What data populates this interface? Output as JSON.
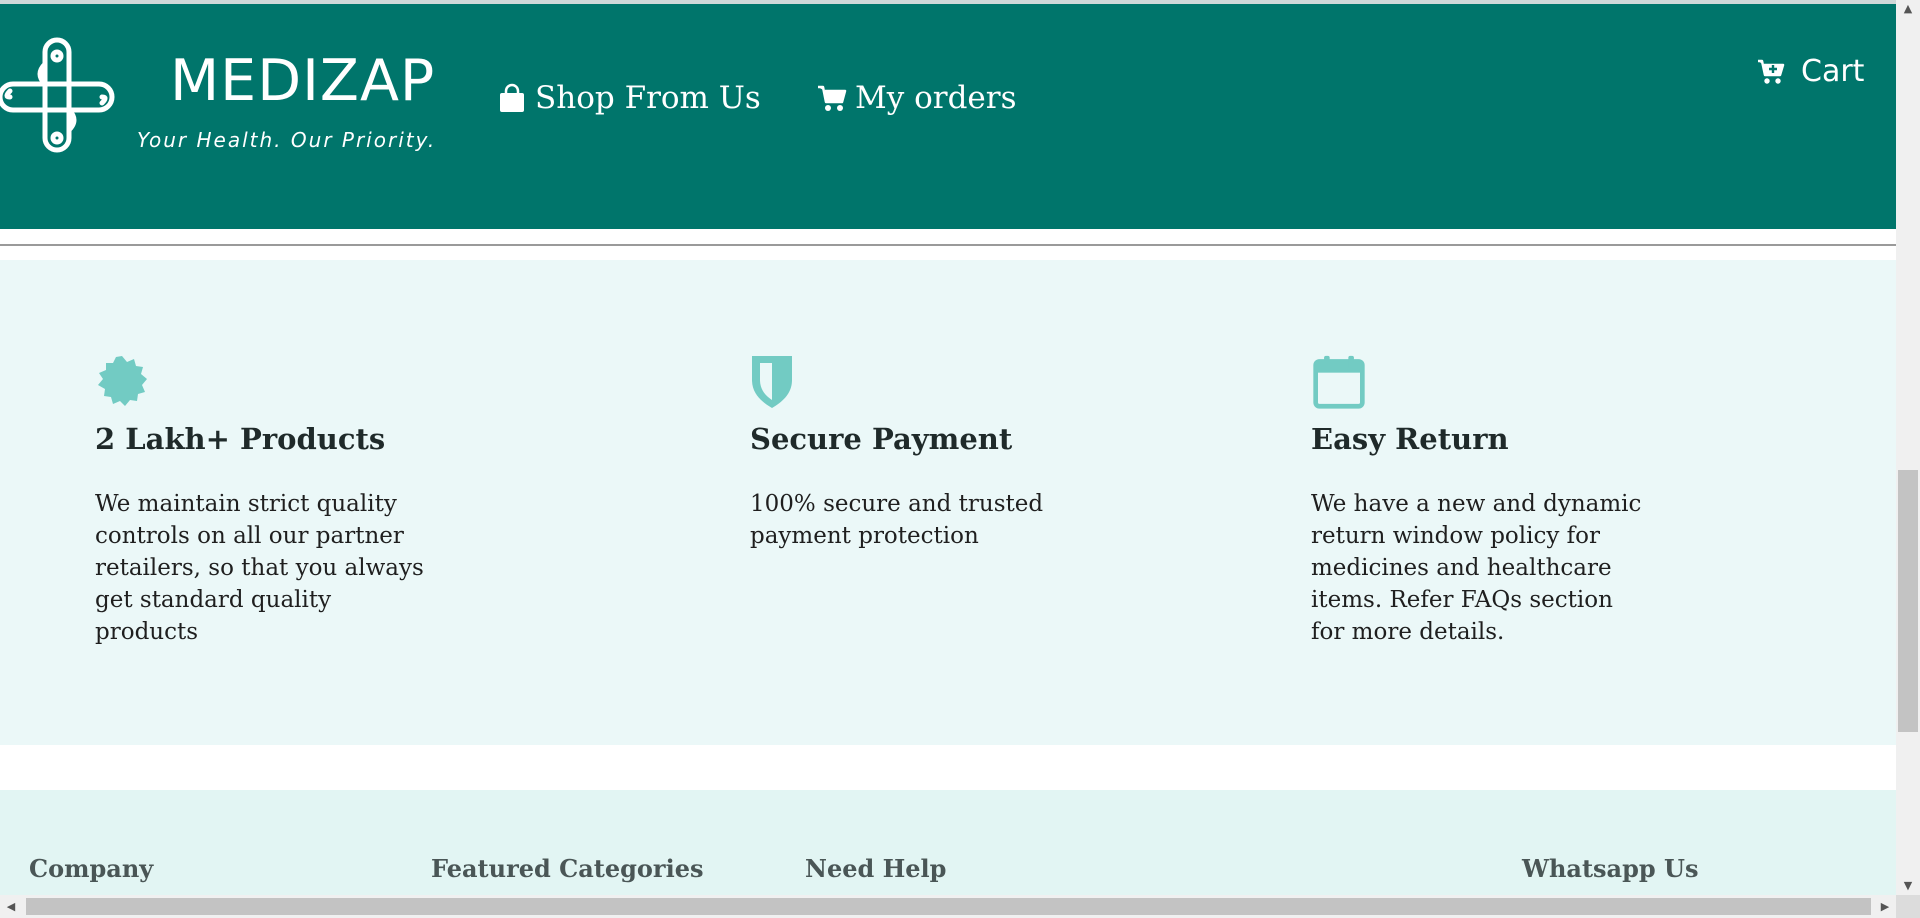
{
  "header": {
    "brand": "MEDIZAP",
    "tagline": "Your Health. Our Priority.",
    "nav": [
      {
        "label": "Shop From Us",
        "icon": "shopping-bag-icon"
      },
      {
        "label": "My orders",
        "icon": "shopping-cart-icon"
      }
    ],
    "cart": {
      "label": "Cart",
      "icon": "cart-plus-icon"
    }
  },
  "features": [
    {
      "icon": "badge-star-icon",
      "title": "2 Lakh+ Products",
      "text": "We maintain strict quality controls on all our partner retailers, so that you always get standard quality products"
    },
    {
      "icon": "shield-icon",
      "title": "Secure Payment",
      "text": "100% secure and trusted payment protection"
    },
    {
      "icon": "calendar-icon",
      "title": "Easy Return",
      "text": "We have a new and dynamic return window policy for medicines and healthcare items. Refer FAQs section for more details."
    }
  ],
  "footer": {
    "headings": [
      "Company",
      "Featured Categories",
      "Need Help",
      "Whatsapp Us"
    ]
  },
  "colors": {
    "header_bg": "#00756b",
    "features_bg": "#ebf8f8",
    "icon_accent": "#72cbc3",
    "footer_bg": "#e2f5f3"
  }
}
